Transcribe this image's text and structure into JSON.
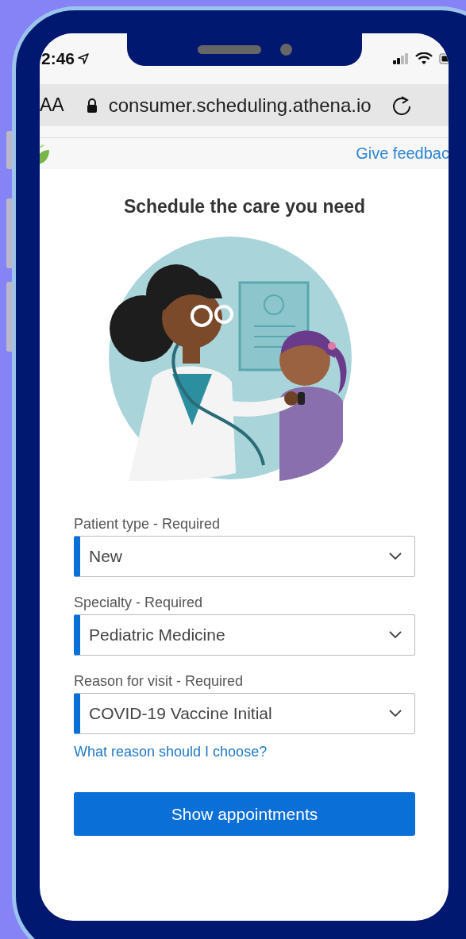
{
  "status_bar": {
    "time": "2:46"
  },
  "browser": {
    "text_size_button": "AA",
    "url": "consumer.scheduling.athena.io"
  },
  "site_header": {
    "feedback_link": "Give feedbac"
  },
  "title": "Schedule the care you need",
  "fields": [
    {
      "label": "Patient type - Required",
      "value": "New"
    },
    {
      "label": "Specialty - Required",
      "value": "Pediatric Medicine"
    },
    {
      "label": "Reason for visit - Required",
      "value": "COVID-19 Vaccine Initial"
    }
  ],
  "help_link": "What reason should I choose?",
  "primary_button": "Show appointments"
}
